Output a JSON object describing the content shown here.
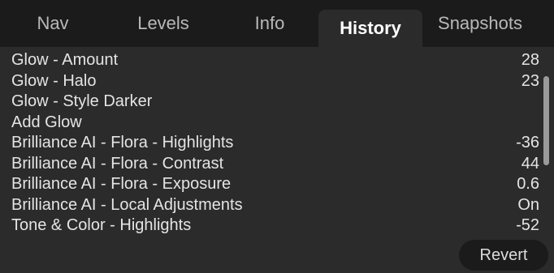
{
  "tabs": [
    {
      "label": "Nav",
      "active": false
    },
    {
      "label": "Levels",
      "active": false
    },
    {
      "label": "Info",
      "active": false
    },
    {
      "label": "History",
      "active": true
    },
    {
      "label": "Snapshots",
      "active": false
    }
  ],
  "history": {
    "items": [
      {
        "label": "Glow - Amount",
        "value": "28"
      },
      {
        "label": "Glow - Halo",
        "value": "23"
      },
      {
        "label": "Glow - Style Darker",
        "value": ""
      },
      {
        "label": "Add Glow",
        "value": ""
      },
      {
        "label": "Brilliance AI - Flora - Highlights",
        "value": "-36"
      },
      {
        "label": "Brilliance AI - Flora - Contrast",
        "value": "44"
      },
      {
        "label": "Brilliance AI - Flora - Exposure",
        "value": "0.6"
      },
      {
        "label": "Brilliance AI - Local Adjustments",
        "value": "On"
      },
      {
        "label": "Tone & Color - Highlights",
        "value": "-52"
      }
    ]
  },
  "actions": {
    "revert_label": "Revert"
  },
  "colors": {
    "panel_background": "#2b2b2b",
    "tabbar_background": "#1b1b1b",
    "active_tab_text": "#ffffff",
    "inactive_tab_text": "#b9b9b9",
    "scrollbar_thumb": "#9a9a9a"
  }
}
